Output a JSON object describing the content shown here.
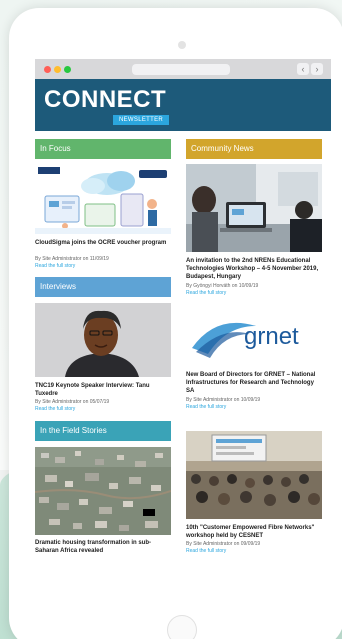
{
  "newsletter": {
    "logo": "CONNECT",
    "badge": "NEWSLETTER"
  },
  "colors": {
    "header_blue": "#1d5a7a",
    "focus_green": "#61b56c",
    "community_yellow": "#d2a52c",
    "interviews_blue": "#5ea3d5",
    "field_teal": "#3aa3b7",
    "link_blue": "#2ba6de"
  },
  "left_column": {
    "sections": [
      {
        "heading": "In Focus",
        "title": "CloudSigma joins the OCRE voucher program",
        "meta": "By Site Administrator on 11/09/19",
        "link": "Read the full story",
        "image_icon": "cloud-illustration"
      },
      {
        "heading": "Interviews",
        "title": "TNC19 Keynote Speaker Interview: Tanu Tuxedre",
        "meta": "By Site Administrator on 05/07/19",
        "link": "Read the full story",
        "image_icon": "portrait-photo"
      },
      {
        "heading": "In the Field Stories",
        "title": "Dramatic housing transformation in sub-Saharan Africa revealed",
        "meta": "",
        "link": "",
        "image_icon": "aerial-city-photo"
      }
    ]
  },
  "right_column": {
    "sections": [
      {
        "heading": "Community News",
        "title": "An invitation to the 2nd NRENs Educational Technologies Workshop – 4-5 November 2019, Budapest, Hungary",
        "meta": "By Gyöngyi Horváth on 10/09/19",
        "link": "Read the full story",
        "image_icon": "laptop-photo"
      },
      {
        "heading": "",
        "title": "New Board of Directors for GRNET – National Infrastructures for Research and Technology SA",
        "meta": "By Site Administrator on 10/09/19",
        "link": "Read the full story",
        "image_icon": "grnet-logo",
        "logo_text": "grnet"
      },
      {
        "heading": "",
        "title": "10th \"Customer Empowered Fibre Networks\" workshop held by CESNET",
        "meta": "By Site Administrator on 09/09/19",
        "link": "Read the full story",
        "image_icon": "conference-room-photo"
      }
    ]
  }
}
